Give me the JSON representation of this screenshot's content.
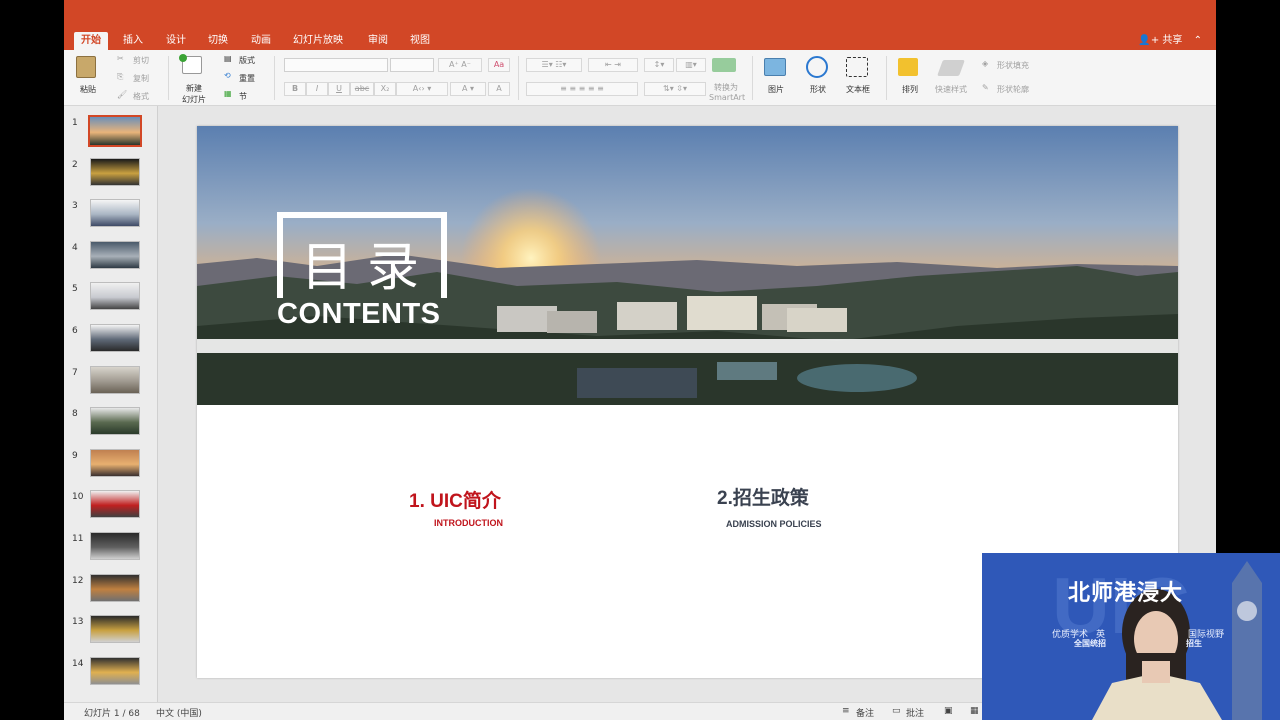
{
  "ribbon_tabs": [
    "开始",
    "插入",
    "设计",
    "切换",
    "动画",
    "幻灯片放映",
    "审阅",
    "视图"
  ],
  "share": {
    "label": "共享",
    "collapse": "⌃"
  },
  "ribbon": {
    "paste": "粘贴",
    "cut": "剪切",
    "copy": "复制",
    "format": "格式",
    "new_slide_1": "新建",
    "new_slide_2": "幻灯片",
    "layout": "版式",
    "reset": "重置",
    "section": "节",
    "convert_1": "转换为",
    "convert_2": "SmartArt",
    "picture": "图片",
    "shapes": "形状",
    "textbox": "文本框",
    "arrange": "排列",
    "quick_styles": "快速样式",
    "shape_fill": "形状填充",
    "shape_outline": "形状轮廓",
    "font_size_up": "A⁺",
    "font_size_down": "A⁻",
    "bold": "B",
    "italic": "I",
    "underline": "U",
    "strike": "abc",
    "subscript": "X₂",
    "font_color": "A",
    "clear_format": "Aa"
  },
  "thumbnails": [
    {
      "num": "1"
    },
    {
      "num": "2"
    },
    {
      "num": "3"
    },
    {
      "num": "4"
    },
    {
      "num": "5"
    },
    {
      "num": "6"
    },
    {
      "num": "7"
    },
    {
      "num": "8"
    },
    {
      "num": "9"
    },
    {
      "num": "10"
    },
    {
      "num": "11"
    },
    {
      "num": "12"
    },
    {
      "num": "13"
    },
    {
      "num": "14"
    }
  ],
  "slide": {
    "toc_cn": "目录",
    "toc_en": "CONTENTS",
    "item1_title": "1. UIC简介",
    "item1_sub": "INTRODUCTION",
    "item2_title": "2.招生政策",
    "item2_sub": "ADMISSION POLICIES"
  },
  "status": {
    "slide_count": "幻灯片 1 / 68",
    "language": "中文 (中国)",
    "notes": "备注",
    "comments": "批注"
  },
  "webcam": {
    "title": "北师港浸大",
    "line1_left": "优质学术",
    "line1_mid": "英",
    "line1_right": "国际视野",
    "line2_left": "全国统招",
    "line2_right": "招生"
  },
  "colors": {
    "accent": "#d24726",
    "item1": "#c0141c",
    "item2": "#3a4250"
  }
}
